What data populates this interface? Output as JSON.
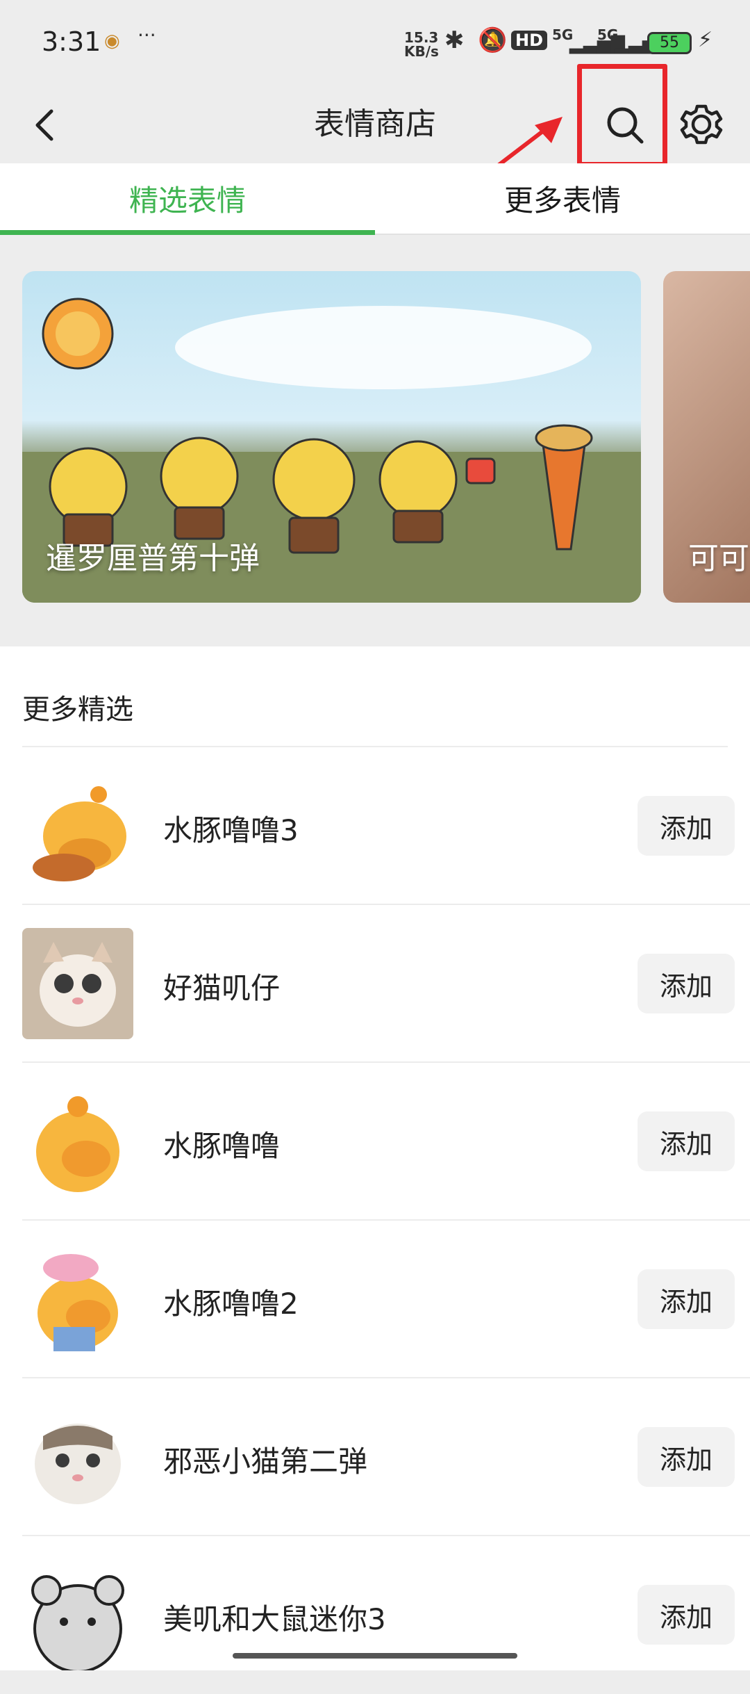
{
  "status_bar": {
    "time": "3:31",
    "more": "···",
    "net_speed": "15.3 KB/s",
    "hd": "HD",
    "signal1": "5G",
    "signal2": "5G",
    "battery": "55"
  },
  "header": {
    "title": "表情商店",
    "back_icon": "chevron-left-icon",
    "search_icon": "search-icon",
    "settings_icon": "gear-icon",
    "highlight_color": "#e8262b"
  },
  "tabs": [
    {
      "label": "精选表情",
      "active": true
    },
    {
      "label": "更多表情",
      "active": false
    }
  ],
  "banners": [
    {
      "caption": "暹罗厘普第十弹"
    },
    {
      "caption": "可可"
    }
  ],
  "section": {
    "title": "更多精选"
  },
  "items": [
    {
      "name": "水豚噜噜3",
      "action": "添加"
    },
    {
      "name": "好猫叽仔",
      "action": "添加"
    },
    {
      "name": "水豚噜噜",
      "action": "添加"
    },
    {
      "name": "水豚噜噜2",
      "action": "添加"
    },
    {
      "name": "邪恶小猫第二弹",
      "action": "添加"
    },
    {
      "name": "美叽和大鼠迷你3",
      "action": "添加"
    }
  ],
  "colors": {
    "accent": "#3fb451",
    "background": "#ededed"
  }
}
